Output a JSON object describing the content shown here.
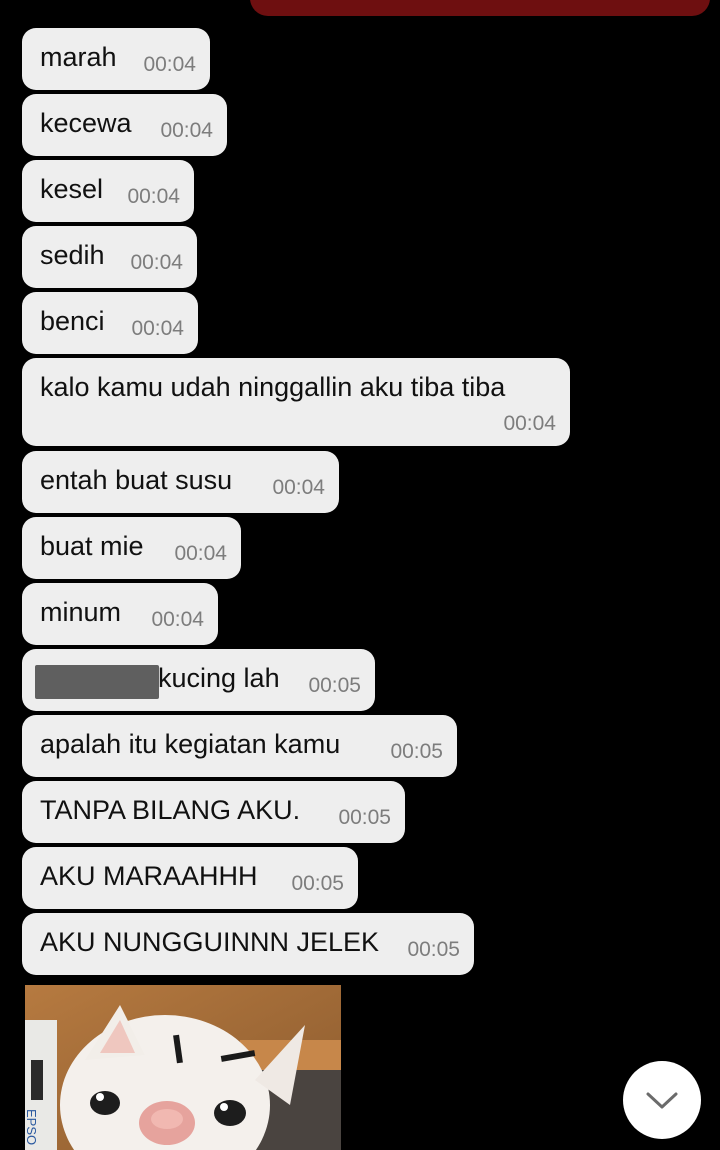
{
  "messages": [
    {
      "text": "marah",
      "time": "00:04"
    },
    {
      "text": "kecewa",
      "time": "00:04"
    },
    {
      "text": "kesel",
      "time": "00:04"
    },
    {
      "text": "sedih",
      "time": "00:04"
    },
    {
      "text": "benci",
      "time": "00:04"
    },
    {
      "text": "kalo kamu udah ninggallin aku tiba tiba",
      "time": "00:04"
    },
    {
      "text": "entah buat susu",
      "time": "00:04"
    },
    {
      "text": "buat mie",
      "time": "00:04"
    },
    {
      "text": "minum",
      "time": "00:04"
    },
    {
      "text": "kucing lah",
      "time": "00:05"
    },
    {
      "text": "apalah itu kegiatan kamu",
      "time": "00:05"
    },
    {
      "text": "TANPA BILANG AKU.",
      "time": "00:05"
    },
    {
      "text": "AKU MARAAHHH",
      "time": "00:05"
    },
    {
      "text": "AKU NUNGGUINNN JELEK",
      "time": "00:05"
    }
  ],
  "photo": {
    "box_label": "EPSO"
  },
  "icons": {
    "scroll_down": "chevron-down-icon"
  },
  "colors": {
    "background": "#000000",
    "bubble": "#eeeeee",
    "sent_bubble": "#6e0f10"
  }
}
